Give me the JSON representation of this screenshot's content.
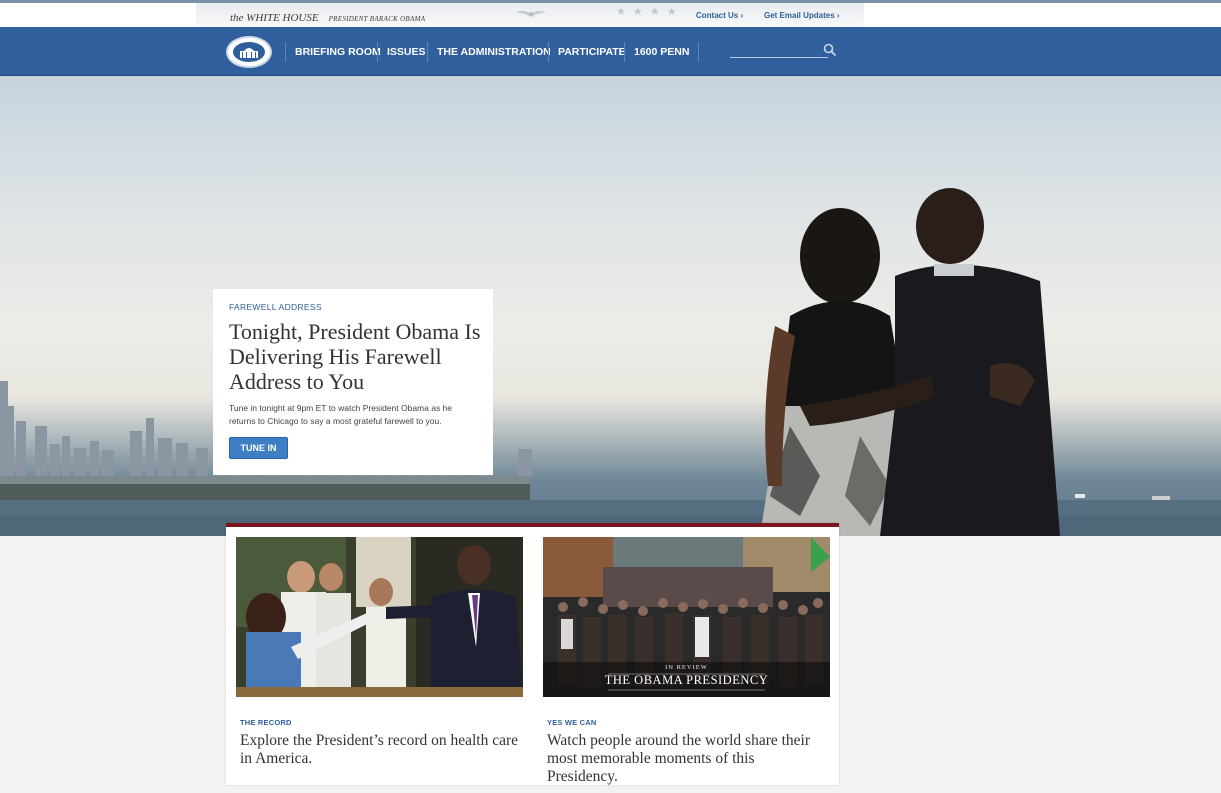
{
  "header": {
    "brand_name": "the WHITE HOUSE",
    "brand_sub": "PRESIDENT BARACK OBAMA",
    "contact_link": "Contact Us",
    "email_link": "Get Email Updates"
  },
  "nav": {
    "items": [
      "BRIEFING ROOM",
      "ISSUES",
      "THE ADMINISTRATION",
      "PARTICIPATE",
      "1600 PENN"
    ],
    "search_placeholder": ""
  },
  "hero": {
    "kicker": "FAREWELL ADDRESS",
    "headline": "Tonight, President Obama Is Delivering His Farewell Address to You",
    "dek": "Tune in tonight at 9pm ET to watch President Obama as he returns to Chicago to say a most grateful farewell to you.",
    "button": "TUNE IN"
  },
  "tiles": [
    {
      "kicker": "THE RECORD",
      "title": "Explore the President’s record on health care in America.",
      "overlay_small": "",
      "overlay_big": ""
    },
    {
      "kicker": "YES WE CAN",
      "title": "Watch people around the world share their most memorable moments of this Presidency.",
      "overlay_small": "IN REVIEW",
      "overlay_big": "THE OBAMA PRESIDENCY"
    }
  ],
  "colors": {
    "nav_blue": "#2f5f9c",
    "accent_red": "#7b1620",
    "link_blue": "#2e5f9a",
    "button_blue": "#3d7fc2"
  }
}
